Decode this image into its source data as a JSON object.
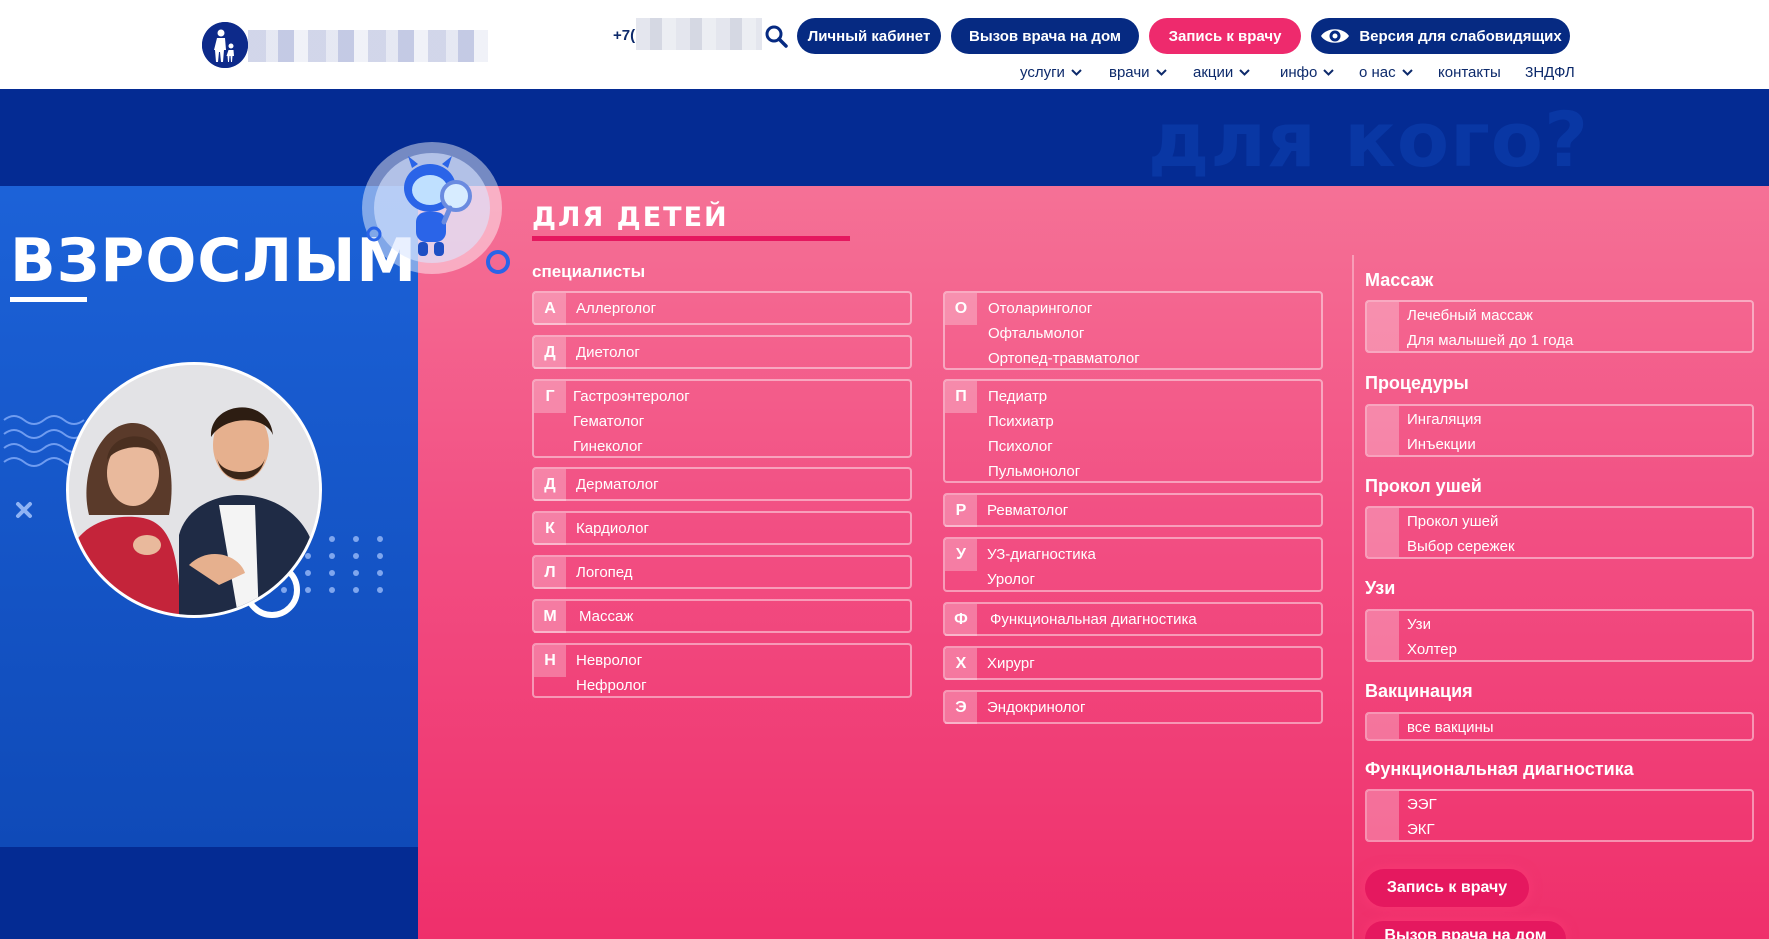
{
  "header": {
    "phone_prefix": "+7(",
    "buttons": {
      "cabinet": "Личный кабинет",
      "doctor_home": "Вызов врача на дом",
      "appointment": "Запись к врачу",
      "low_vision": "Версия для слабовидящих"
    },
    "nav": [
      "услуги",
      "врачи",
      "акции",
      "инфо",
      "о нас",
      "контакты",
      "3НДФЛ"
    ]
  },
  "banner": {
    "ghost_text": "для кого?"
  },
  "adults": {
    "title": "ВЗРОСЛЫМ"
  },
  "kids": {
    "title": "ДЛЯ ДЕТЕЙ",
    "specialists_label": "специалисты",
    "col1": [
      {
        "letter": "А",
        "items": [
          "Аллерголог"
        ]
      },
      {
        "letter": "Д",
        "items": [
          "Диетолог"
        ]
      },
      {
        "letter": "Г",
        "items": [
          "Гастроэнтеролог",
          "Гематолог",
          "Гинеколог"
        ]
      },
      {
        "letter": "Д",
        "items": [
          "Дерматолог"
        ]
      },
      {
        "letter": "К",
        "items": [
          "Кардиолог"
        ]
      },
      {
        "letter": "Л",
        "items": [
          "Логопед"
        ]
      },
      {
        "letter": "М",
        "items": [
          "Массаж"
        ]
      },
      {
        "letter": "Н",
        "items": [
          "Невролог",
          "Нефролог"
        ]
      }
    ],
    "col2": [
      {
        "letter": "О",
        "items": [
          "Отоларинголог",
          "Офтальмолог",
          "Ортопед-травматолог"
        ]
      },
      {
        "letter": "П",
        "items": [
          "Педиатр",
          "Психиатр",
          "Психолог",
          "Пульмонолог"
        ]
      },
      {
        "letter": "Р",
        "items": [
          "Ревматолог"
        ]
      },
      {
        "letter": "У",
        "items": [
          "УЗ-диагностика",
          "Уролог"
        ]
      },
      {
        "letter": "Ф",
        "items": [
          "Функциональная диагностика"
        ]
      },
      {
        "letter": "Х",
        "items": [
          "Хирург"
        ]
      },
      {
        "letter": "Э",
        "items": [
          "Эндокринолог"
        ]
      }
    ],
    "services": [
      {
        "title": "Массаж",
        "items": [
          "Лечебный массаж",
          "Для малышей до 1 года"
        ]
      },
      {
        "title": "Процедуры",
        "items": [
          "Ингаляция",
          "Инъекции"
        ]
      },
      {
        "title": "Прокол ушей",
        "items": [
          "Прокол ушей",
          "Выбор сережек"
        ]
      },
      {
        "title": "Узи",
        "items": [
          "Узи",
          "Холтер"
        ]
      },
      {
        "title": "Вакцинация",
        "items": [
          "все вакцины"
        ]
      },
      {
        "title": "Функциональная диагностика",
        "items": [
          "ЭЭГ",
          "ЭКГ"
        ]
      }
    ],
    "cta_appointment": "Запись к врачу",
    "cta_home": "Вызов врача на дом"
  },
  "colors": {
    "navy": "#062a82",
    "pink": "#ee2a6d",
    "blue": "#1c62d8",
    "kids_bg": "#f24f83"
  }
}
